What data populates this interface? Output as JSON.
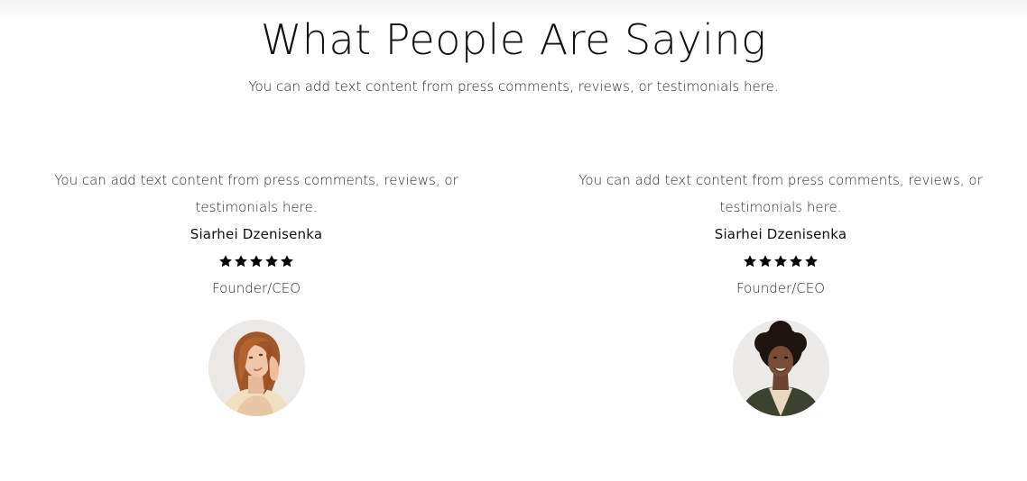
{
  "section": {
    "title": "What People Are Saying",
    "subtitle": "You can add text content from press comments, reviews, or testimonials here."
  },
  "testimonials": [
    {
      "quote": "You can add text content from press comments, reviews, or testimonials here.",
      "author": "Siarhei Dzenisenka",
      "rating": 5,
      "role": "Founder/CEO",
      "avatar_icon": "woman-portrait-avatar"
    },
    {
      "quote": "You can add text content from press comments, reviews, or testimonials here.",
      "author": "Siarhei Dzenisenka",
      "rating": 5,
      "role": "Founder/CEO",
      "avatar_icon": "woman-portrait-avatar"
    }
  ],
  "colors": {
    "text": "#111111",
    "star": "#000000",
    "background": "#ffffff"
  }
}
